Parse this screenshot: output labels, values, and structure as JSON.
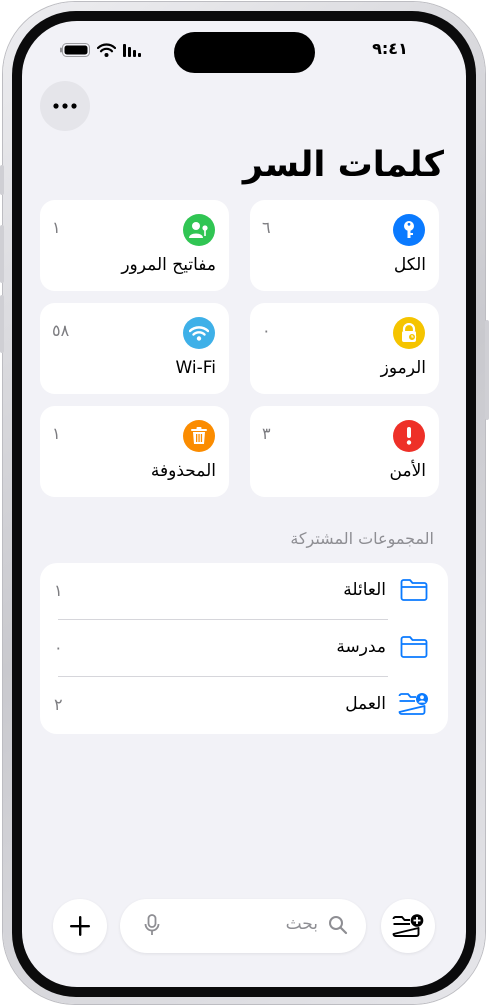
{
  "status": {
    "time": "٩:٤١"
  },
  "header": {
    "title": "كلمات السر"
  },
  "categories": [
    {
      "label": "الكل",
      "count": "٦",
      "icon": "key-icon",
      "color": "#0a7aff"
    },
    {
      "label": "مفاتيح المرور",
      "count": "١",
      "icon": "person-key-icon",
      "color": "#30c553"
    },
    {
      "label": "الرموز",
      "count": "٠",
      "icon": "lock-clock-icon",
      "color": "#f5c400"
    },
    {
      "label": "Wi-Fi",
      "count": "٥٨",
      "icon": "wifi-icon",
      "color": "#3eb0e8"
    },
    {
      "label": "الأمن",
      "count": "٣",
      "icon": "exclamation-icon",
      "color": "#ee3028"
    },
    {
      "label": "المحذوفة",
      "count": "١",
      "icon": "trash-icon",
      "color": "#fb8c00"
    }
  ],
  "shared_groups": {
    "title": "المجموعات المشتركة",
    "items": [
      {
        "label": "العائلة",
        "count": "١",
        "icon": "folder-icon"
      },
      {
        "label": "مدرسة",
        "count": "٠",
        "icon": "folder-icon"
      },
      {
        "label": "العمل",
        "count": "٢",
        "icon": "folder-person-icon"
      }
    ]
  },
  "search": {
    "placeholder": "بحث"
  },
  "colors": {
    "accent": "#0a7aff",
    "background": "#f2f2f7"
  }
}
